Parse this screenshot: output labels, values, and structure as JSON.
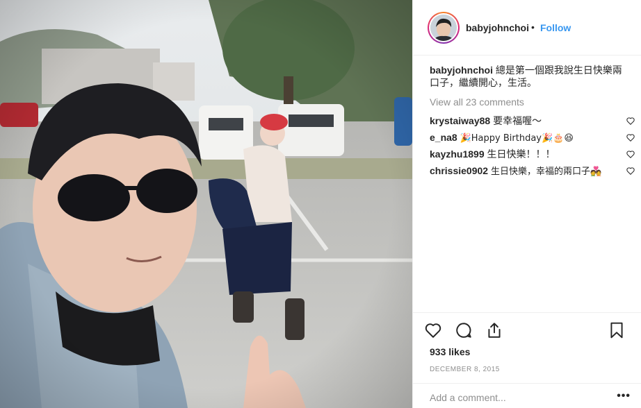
{
  "post": {
    "username": "babyjohnchoi",
    "separator": "•",
    "follow_label": "Follow",
    "caption_text": "總是第一個跟我說生日快樂兩口子，繼續開心，生活。",
    "view_all": "View all 23 comments",
    "likes": "933 likes",
    "date": "DECEMBER 8, 2015",
    "add_comment_placeholder": "Add a comment...",
    "more_label": "•••"
  },
  "comments": [
    {
      "username": "krystaiway88",
      "text": "要幸福喔～"
    },
    {
      "username": "e_na8",
      "text": "🎉Happy Birthday🎉🎂😆"
    },
    {
      "username": "kayzhu1899",
      "text": "生日快樂！！！"
    },
    {
      "username": "chrissie0902",
      "text": "生日快樂，幸福的兩口子💑"
    }
  ],
  "icons": {
    "like": "heart-icon",
    "comment": "speech-bubble-icon",
    "share": "share-icon",
    "save": "bookmark-icon",
    "comment_like": "heart-icon"
  },
  "colors": {
    "follow": "#3897f0",
    "muted": "#8e8e8e",
    "text": "#262626"
  }
}
